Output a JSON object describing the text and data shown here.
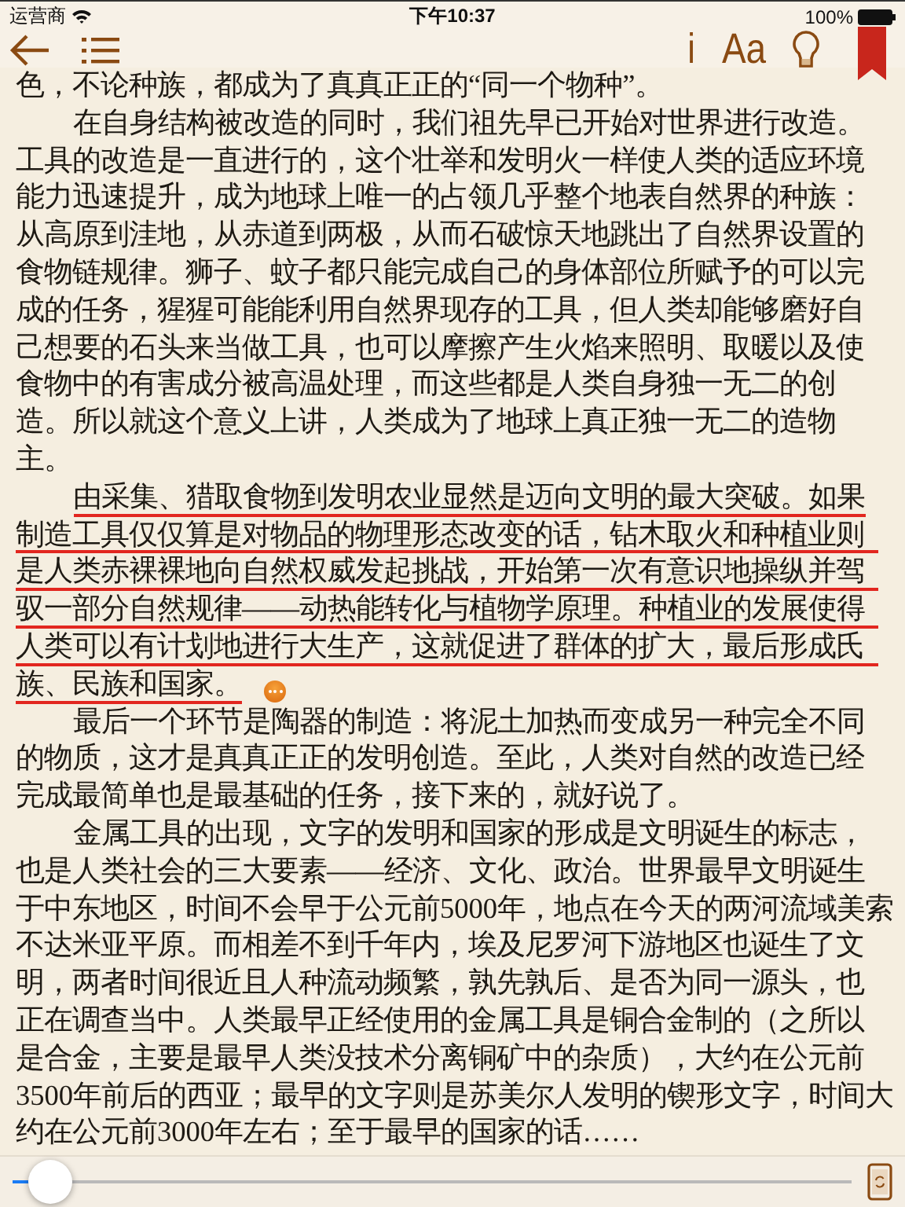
{
  "status_bar": {
    "carrier": "运营商",
    "time": "下午10:37",
    "battery": "100%"
  },
  "toolbar": {
    "info": "i",
    "font": "Aa"
  },
  "paragraphs": [
    {
      "indent": false,
      "underlined": false,
      "lines": [
        "色，不论种族，都成为了真真正正的“同一个物种”。"
      ]
    },
    {
      "indent": true,
      "underlined": false,
      "lines": [
        "在自身结构被改造的同时，我们祖先早已开始对世界进行改造。",
        "工具的改造是一直进行的，这个壮举和发明火一样使人类的适应环境",
        "能力迅速提升，成为地球上唯一的占领几乎整个地表自然界的种族：",
        "从高原到洼地，从赤道到两极，从而石破惊天地跳出了自然界设置的",
        "食物链规律。狮子、蚊子都只能完成自己的身体部位所赋予的可以完",
        "成的任务，猩猩可能能利用自然界现存的工具，但人类却能够磨好自",
        "己想要的石头来当做工具，也可以摩擦产生火焰来照明、取暖以及使",
        "食物中的有害成分被高温处理，而这些都是人类自身独一无二的创",
        "造。所以就这个意义上讲，人类成为了地球上真正独一无二的造物",
        "主。"
      ]
    },
    {
      "indent": true,
      "underlined": true,
      "note": true,
      "lines": [
        "由采集、猎取食物到发明农业显然是迈向文明的最大突破。如果",
        "制造工具仅仅算是对物品的物理形态改变的话，钻木取火和种植业则",
        "是人类赤裸裸地向自然权威发起挑战，开始第一次有意识地操纵并驾",
        "驭一部分自然规律——动热能转化与植物学原理。种植业的发展使得",
        "人类可以有计划地进行大生产，这就促进了群体的扩大，最后形成氏",
        "族、民族和国家。"
      ]
    },
    {
      "indent": true,
      "underlined": false,
      "lines": [
        "最后一个环节是陶器的制造：将泥土加热而变成另一种完全不同",
        "的物质，这才是真真正正的发明创造。至此，人类对自然的改造已经",
        "完成最简单也是最基础的任务，接下来的，就好说了。"
      ]
    },
    {
      "indent": true,
      "underlined": false,
      "lines": [
        "金属工具的出现，文字的发明和国家的形成是文明诞生的标志，",
        "也是人类社会的三大要素——经济、文化、政治。世界最早文明诞生",
        "于中东地区，时间不会早于公元前5000年，地点在今天的两河流域美索",
        "不达米亚平原。而相差不到千年内，埃及尼罗河下游地区也诞生了文",
        "明，两者时间很近且人种流动频繁，孰先孰后、是否为同一源头，也",
        "正在调查当中。人类最早正经使用的金属工具是铜合金制的（之所以",
        "是合金，主要是最早人类没技术分离铜矿中的杂质），大约在公元前",
        "3500年前后的西亚；最早的文字则是苏美尔人发明的锲形文字，时间大",
        "约在公元前3000年左右；至于最早的国家的话……"
      ]
    }
  ],
  "progress": {
    "level": 0.02
  }
}
